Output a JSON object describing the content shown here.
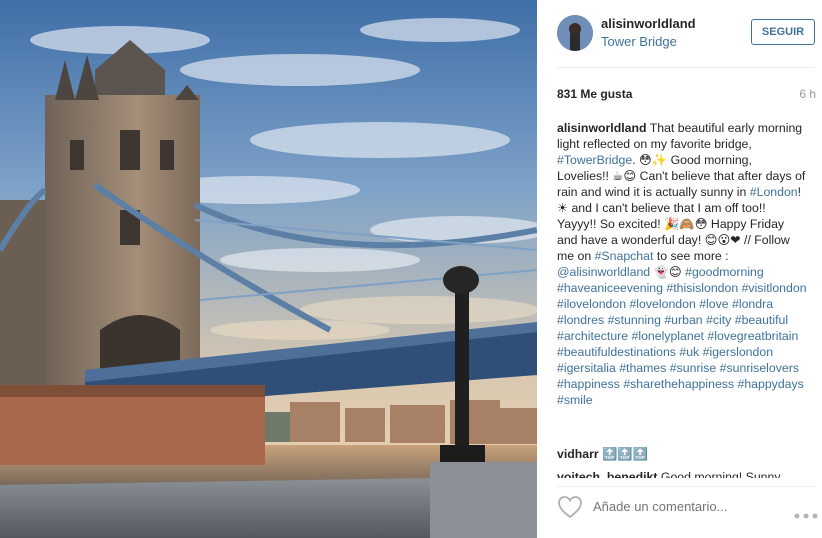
{
  "post": {
    "username": "alisinworldland",
    "location": "Tower Bridge",
    "follow_label": "SEGUIR",
    "likes": "831 Me gusta",
    "time": "6 h",
    "caption": {
      "author": "alisinworldland",
      "segments": [
        {
          "t": "That beautiful early morning light reflected on my favorite bridge, "
        },
        {
          "t": "#TowerBridge",
          "tag": true
        },
        {
          "t": ". 😳✨ Good morning, Lovelies!! ☕😊 Can't believe that after days of rain and wind it is actually sunny in "
        },
        {
          "t": "#London",
          "tag": true
        },
        {
          "t": "! ☀ and I can't believe that I am off too!! Yayyy!! So excited! 🎉🙈😳 Happy Friday and have a wonderful day! 😊😮❤ // Follow me on "
        },
        {
          "t": "#Snapchat",
          "tag": true
        },
        {
          "t": " to see more : "
        },
        {
          "t": "@alisinworldland",
          "tag": true
        },
        {
          "t": " 👻😊 "
        },
        {
          "t": "#goodmorning #haveaniceevening #thisislondon #visitlondon #ilovelondon #lovelondon #love #londra #londres #stunning #urban #city #beautiful #architecture #lonelyplanet #lovegreatbritain #beautifuldestinations #uk #igerslondon #igersitalia #thames #sunrise #sunriselovers #happiness #sharethehappiness #happydays #smile",
          "tag": true
        }
      ]
    },
    "comments": [
      {
        "user": "vidharr",
        "text": "🔝🔝🔝"
      },
      {
        "user": "voitech_benedikt",
        "text": "Good morning! Sunny"
      }
    ],
    "comment_placeholder": "Añade un comentario..."
  },
  "icons": {
    "like": "heart-icon",
    "more": "more-options-icon"
  },
  "colors": {
    "link": "#3f729b",
    "text": "#262626",
    "muted": "#999999",
    "divider": "#efefef"
  }
}
